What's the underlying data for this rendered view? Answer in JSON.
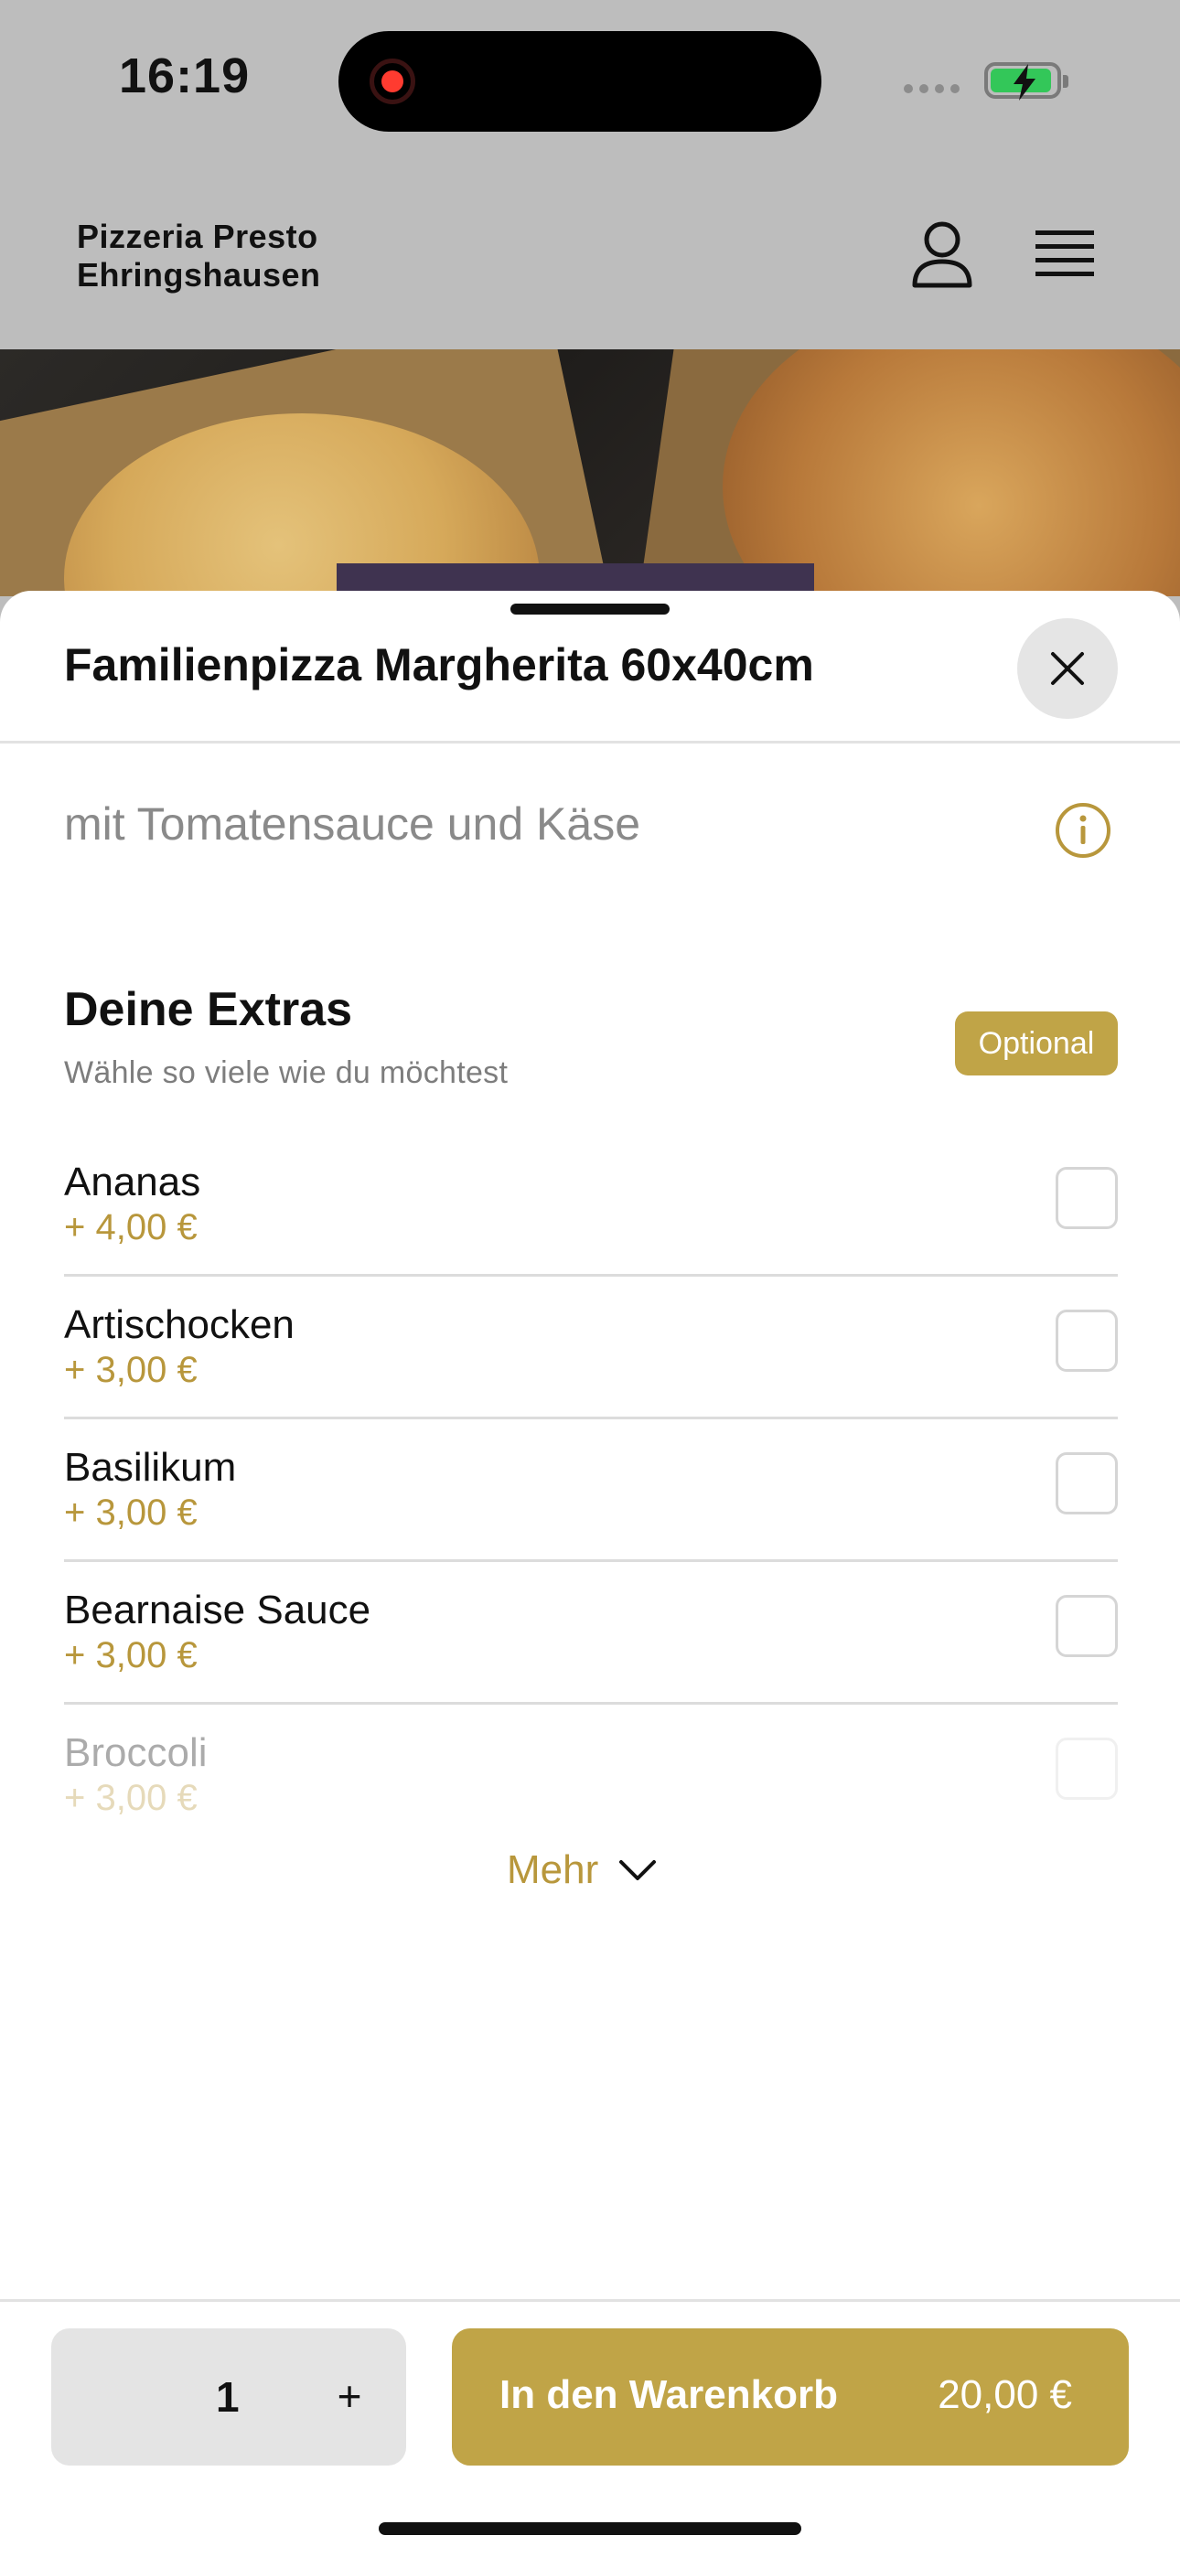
{
  "status_bar": {
    "time": "16:19"
  },
  "header": {
    "brand_line1": "Pizzeria Presto",
    "brand_line2": "Ehringshausen"
  },
  "sheet": {
    "title": "Familienpizza Margherita 60x40cm",
    "description": "mit Tomatensauce und Käse",
    "extras": {
      "title": "Deine Extras",
      "subtitle": "Wähle so viele wie du möchtest",
      "badge": "Optional",
      "options": [
        {
          "name": "Ananas",
          "price": "+ 4,00 €"
        },
        {
          "name": "Artischocken",
          "price": "+ 3,00 €"
        },
        {
          "name": "Basilikum",
          "price": "+ 3,00 €"
        },
        {
          "name": "Bearnaise Sauce",
          "price": "+ 3,00 €"
        },
        {
          "name": "Broccoli",
          "price": "+ 3,00 €"
        }
      ],
      "more_label": "Mehr"
    }
  },
  "footer": {
    "quantity": "1",
    "plus_label": "+",
    "cart_label": "In den Warenkorb",
    "cart_price": "20,00 €"
  },
  "colors": {
    "accent": "#c0a447",
    "price": "#b8973c",
    "overlay": "#bdbdbd"
  },
  "icons": [
    "record-icon",
    "battery-charging-icon",
    "user-icon",
    "menu-icon",
    "close-icon",
    "info-icon",
    "chevron-down-icon"
  ]
}
